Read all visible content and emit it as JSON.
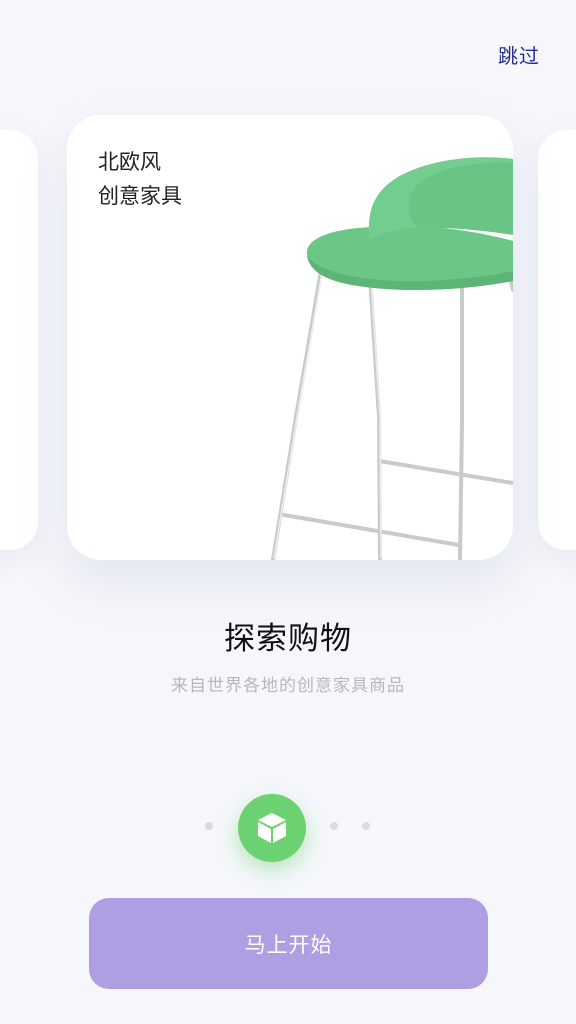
{
  "header": {
    "skip_label": "跳过"
  },
  "card": {
    "line1": "北欧风",
    "line2": "创意家具",
    "image": "green-bar-stool"
  },
  "onboarding": {
    "title": "探索购物",
    "subtitle": "来自世界各地的创意家具商品"
  },
  "pager": {
    "active_icon": "cube-icon",
    "active_index": 2,
    "total": 4
  },
  "cta": {
    "label": "马上开始"
  },
  "colors": {
    "accent_purple": "#b09ee3",
    "active_green": "#6cd271",
    "skip_blue": "#2b2f8f",
    "stool_green": "#6cc786"
  }
}
